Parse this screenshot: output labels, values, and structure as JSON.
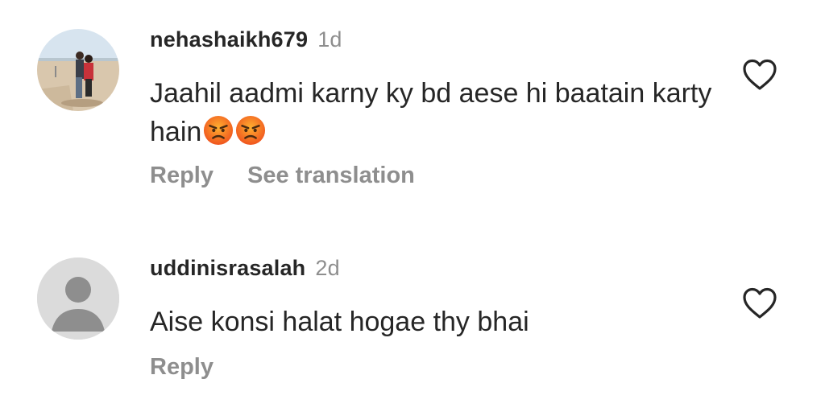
{
  "comments": [
    {
      "username": "nehashaikh679",
      "time": "1d",
      "text": "Jaahil aadmi karny ky bd aese hi baatain karty hain",
      "emojis": [
        "angry-face-icon",
        "angry-face-icon"
      ],
      "reply_label": "Reply",
      "translate_label": "See translation"
    },
    {
      "username": "uddinisrasalah",
      "time": "2d",
      "text": "Aise konsi halat hogae thy bhai",
      "reply_label": "Reply"
    }
  ],
  "colors": {
    "text": "#262626",
    "secondary": "#8e8e8e",
    "default_avatar_bg": "#dbdbdb",
    "default_avatar_fg": "#8e8e8e"
  }
}
